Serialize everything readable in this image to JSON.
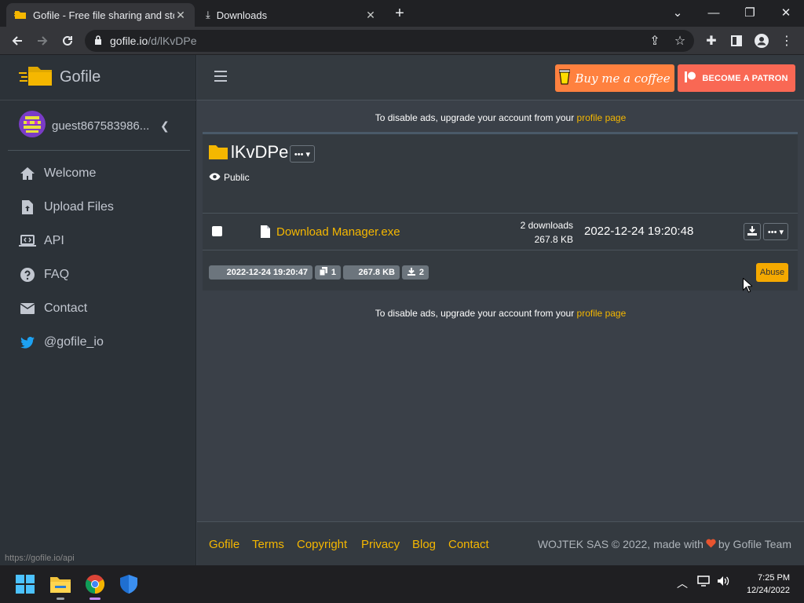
{
  "browser": {
    "tabs": [
      {
        "title": "Gofile - Free file sharing and stor",
        "active": true
      },
      {
        "title": "Downloads",
        "active": false
      }
    ],
    "url_host": "gofile.io",
    "url_path": "/d/lKvDPe"
  },
  "brand": {
    "name": "Gofile"
  },
  "user": {
    "name": "guest867583986..."
  },
  "nav": {
    "items": [
      {
        "label": "Welcome",
        "icon": "home-icon"
      },
      {
        "label": "Upload Files",
        "icon": "file-upload-icon"
      },
      {
        "label": "API",
        "icon": "laptop-code-icon"
      },
      {
        "label": "FAQ",
        "icon": "question-circle-icon"
      },
      {
        "label": "Contact",
        "icon": "envelope-icon"
      },
      {
        "label": "@gofile_io",
        "icon": "twitter-icon"
      }
    ]
  },
  "header": {
    "coffee_label": "Buy me a coffee",
    "patron_label": "BECOME A PATRON"
  },
  "ads": {
    "text": "To disable ads, upgrade your account from your ",
    "link": "profile page"
  },
  "folder": {
    "name": "lKvDPe",
    "menu_label": "••• ▾",
    "visibility": "Public",
    "file": {
      "name": "Download Manager.exe",
      "downloads": "2 downloads",
      "size": "267.8 KB",
      "date": "2022-12-24 19:20:48"
    },
    "badges": {
      "created": "2022-12-24 19:20:47",
      "children": "1",
      "total_size": "267.8 KB",
      "total_downloads": "2"
    },
    "abuse_label": "Abuse"
  },
  "footer": {
    "links": [
      "Gofile",
      "Terms",
      "Copyright",
      "Privacy",
      "Blog",
      "Contact"
    ],
    "copyright_prefix": "WOJTEK SAS © 2022, made with",
    "copyright_suffix": "by Gofile Team"
  },
  "status_url": "https://gofile.io/api",
  "taskbar": {
    "time": "7:25 PM",
    "date": "12/24/2022"
  },
  "colors": {
    "accent": "#f5b700",
    "sidebar": "#2c3238",
    "content": "#3a4048"
  }
}
